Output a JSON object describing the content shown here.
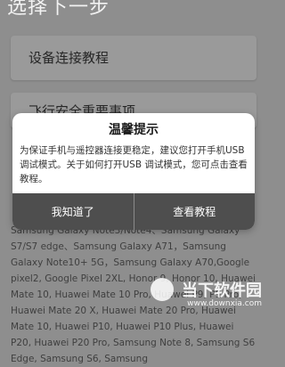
{
  "page": {
    "title": "选择下一步"
  },
  "options": [
    {
      "label": "设备连接教程"
    },
    {
      "label": "飞行安全重要事项"
    }
  ],
  "device_list": {
    "text": "Samsung Galaxy Note3/Note4、Samsung Galaxy S7/S7 edge、Samsung Galaxy A71，Samsung Galaxy Note10+ 5G，Samsung Galaxy A70,Google pixel2, Google Pixel 2XL, Honor 9, Honor 10, Huawei Mate 10, Huawei Mate 10 Pro, Huawei P9, P9 Pro, Huawei Mate 20 X, Huawei Mate 20 Pro, Huawei Mate 10, Huawei P10, Huawei P10 Plus, Huawei P20, Huawei P20 Pro, Samsung Note 8, Samsung S6 Edge, Samsung S6, Samsung"
  },
  "dialog": {
    "title": "温馨提示",
    "message": "为保证手机与遥控器连接更稳定，建议您打开手机USB调试模式。关于如何打开USB 调试模式，您可点击查看教程。",
    "primary_button": "我知道了",
    "secondary_button": "查看教程"
  },
  "watermark": {
    "title": "当下软件园",
    "subtitle": "www.downxia.com"
  }
}
